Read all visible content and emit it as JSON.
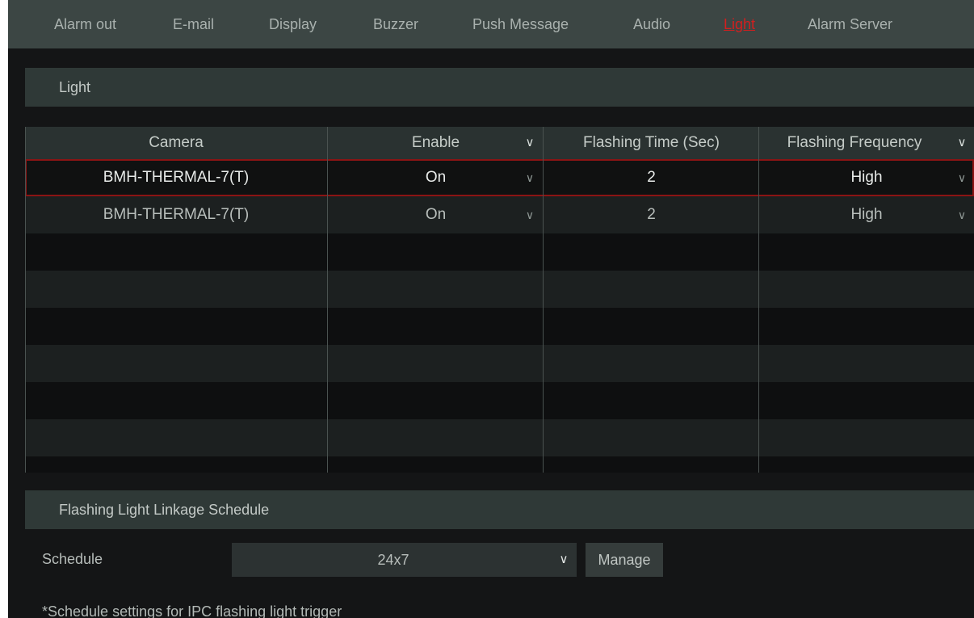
{
  "tabs": [
    {
      "label": "Alarm out",
      "active": false
    },
    {
      "label": "E-mail",
      "active": false
    },
    {
      "label": "Display",
      "active": false
    },
    {
      "label": "Buzzer",
      "active": false
    },
    {
      "label": "Push Message",
      "active": false
    },
    {
      "label": "Audio",
      "active": false
    },
    {
      "label": "Light",
      "active": true
    },
    {
      "label": "Alarm Server",
      "active": false
    }
  ],
  "light_section": {
    "title": "Light"
  },
  "table": {
    "columns": {
      "camera": "Camera",
      "enable": "Enable",
      "flashing_time": "Flashing Time (Sec)",
      "flashing_frequency": "Flashing Frequency"
    },
    "rows": [
      {
        "camera": "BMH-THERMAL-7(T)",
        "enable": "On",
        "flashing_time": "2",
        "flashing_frequency": "High",
        "selected": true
      },
      {
        "camera": "BMH-THERMAL-7(T)",
        "enable": "On",
        "flashing_time": "2",
        "flashing_frequency": "High",
        "selected": false
      }
    ]
  },
  "schedule_section": {
    "title": "Flashing Light Linkage Schedule",
    "schedule_label": "Schedule",
    "schedule_value": "24x7",
    "manage_label": "Manage",
    "note": "*Schedule settings for IPC flashing light trigger"
  },
  "colors": {
    "active_tab": "#d21f1f",
    "selected_row_border": "#8b1414",
    "background": "#141516"
  },
  "icons": {
    "dropdown": "chevron-down-icon"
  }
}
